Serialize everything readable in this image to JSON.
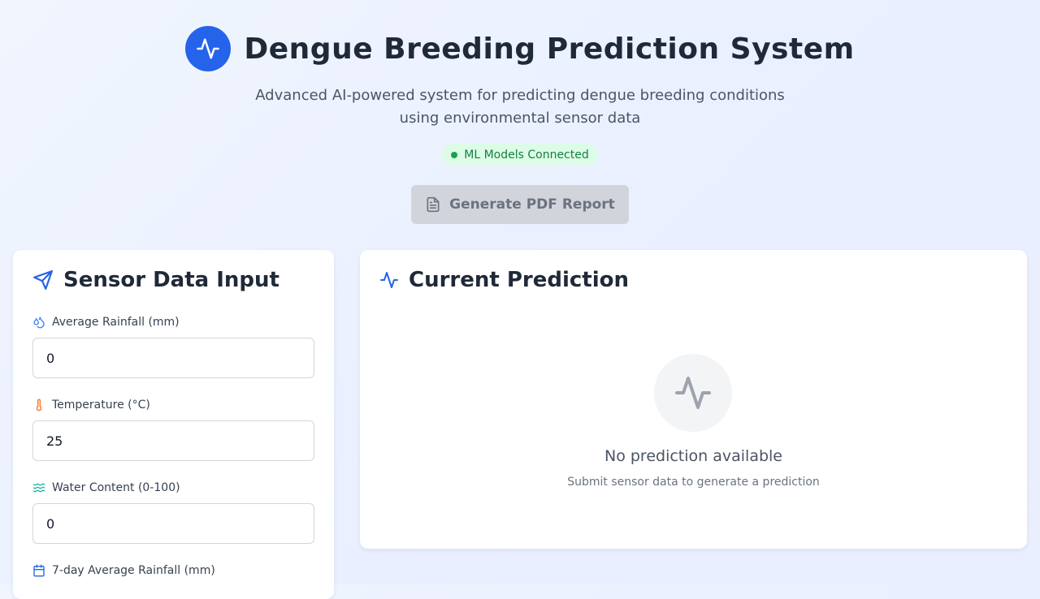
{
  "header": {
    "title": "Dengue Breeding Prediction System",
    "subtitle_line1": "Advanced AI-powered system for predicting dengue breeding conditions",
    "subtitle_line2": "using environmental sensor data",
    "status": "ML Models Connected",
    "pdf_button": "Generate PDF Report",
    "accent_color": "#2563eb",
    "status_color": "#16a34a"
  },
  "sensor_panel": {
    "title": "Sensor Data Input",
    "fields": [
      {
        "label": "Average Rainfall (mm)",
        "value": "0",
        "icon": "droplets-icon"
      },
      {
        "label": "Temperature (°C)",
        "value": "25",
        "icon": "thermometer-icon"
      },
      {
        "label": "Water Content (0-100)",
        "value": "0",
        "icon": "waves-icon"
      },
      {
        "label": "7-day Average Rainfall (mm)",
        "value": "",
        "icon": "calendar-icon"
      }
    ]
  },
  "prediction_panel": {
    "title": "Current Prediction",
    "empty_title": "No prediction available",
    "empty_subtitle": "Submit sensor data to generate a prediction"
  }
}
